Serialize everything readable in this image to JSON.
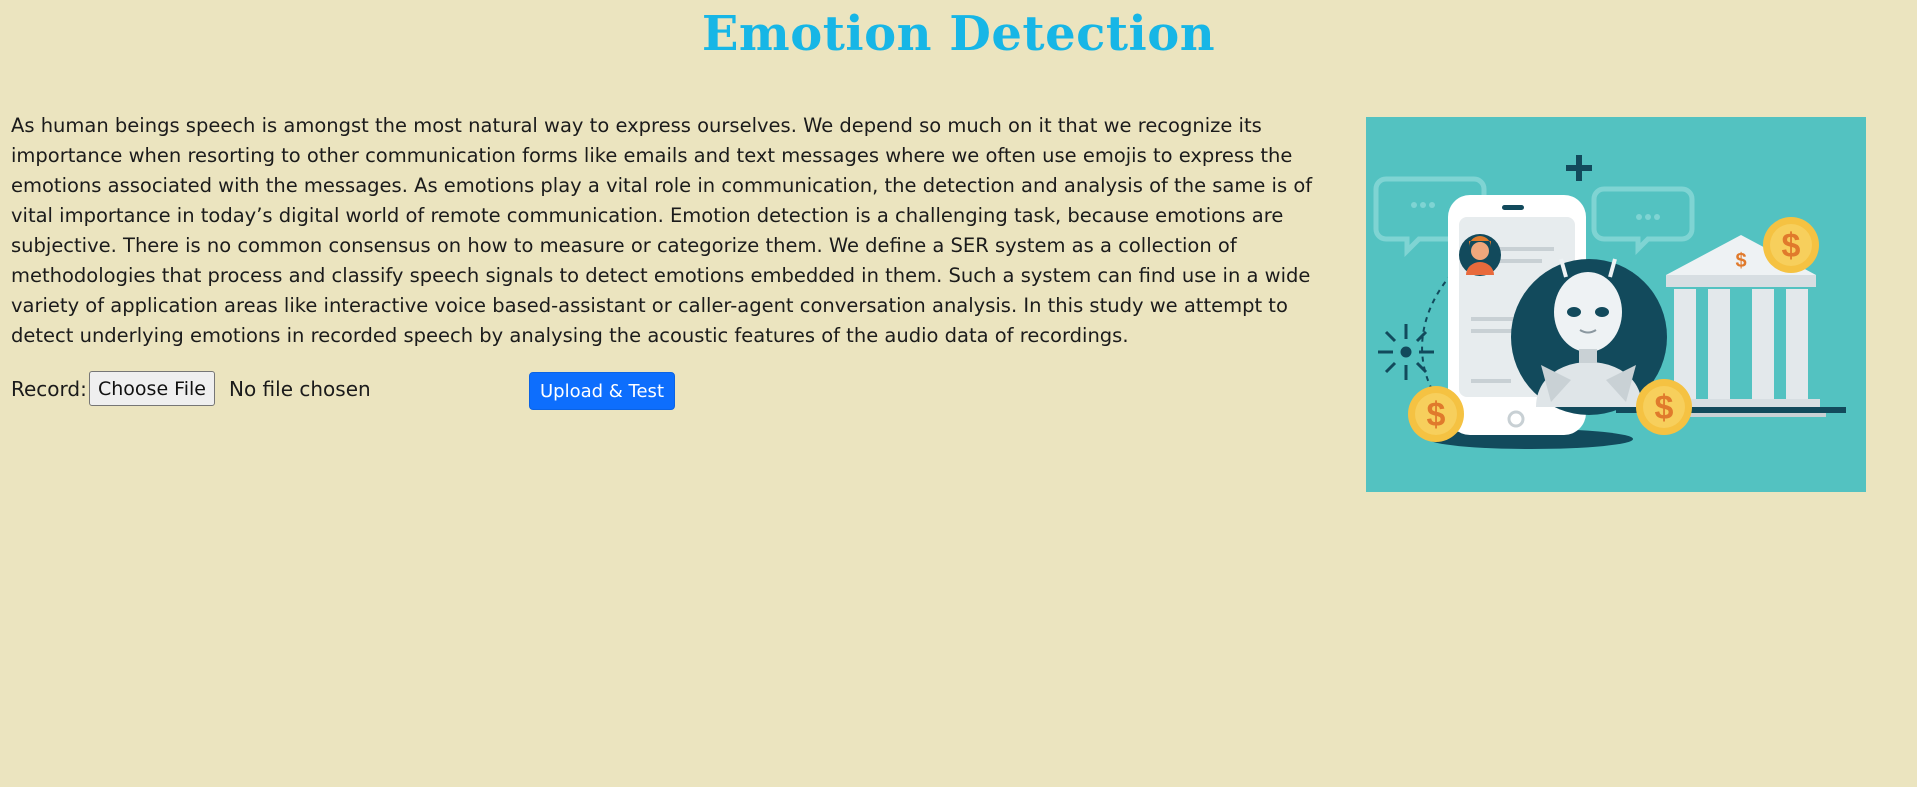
{
  "page": {
    "title": "Emotion Detection",
    "description": "As human beings speech is amongst the most natural way to express ourselves. We depend so much on it that we recognize its importance when resorting to other communication forms like emails and text messages where we often use emojis to express the emotions associated with the messages. As emotions play a vital role in communication, the detection and analysis of the same is of vital importance in today’s digital world of remote communication. Emotion detection is a challenging task, because emotions are subjective. There is no common consensus on how to measure or categorize them. We define a SER system as a collection of methodologies that process and classify speech signals to detect emotions embedded in them. Such a system can find use in a wide variety of application areas like interactive voice based-assistant or caller-agent conversation analysis. In this study we attempt to detect underlying emotions in recorded speech by analysing the acoustic features of the audio data of recordings."
  },
  "form": {
    "record_label": "Record:",
    "file_button_label": "Choose File",
    "file_status": "No file chosen",
    "upload_button_label": "Upload & Test"
  },
  "colors": {
    "background": "#ebe4bf",
    "title": "#17b6e6",
    "upload_button": "#0d6efd",
    "illustration_background": "#53c2c1"
  },
  "illustration": {
    "icons": [
      "smartphone-icon",
      "robot-icon",
      "bank-building-icon",
      "dollar-coin-icon",
      "chat-bubble-icon",
      "user-avatar-icon"
    ]
  }
}
